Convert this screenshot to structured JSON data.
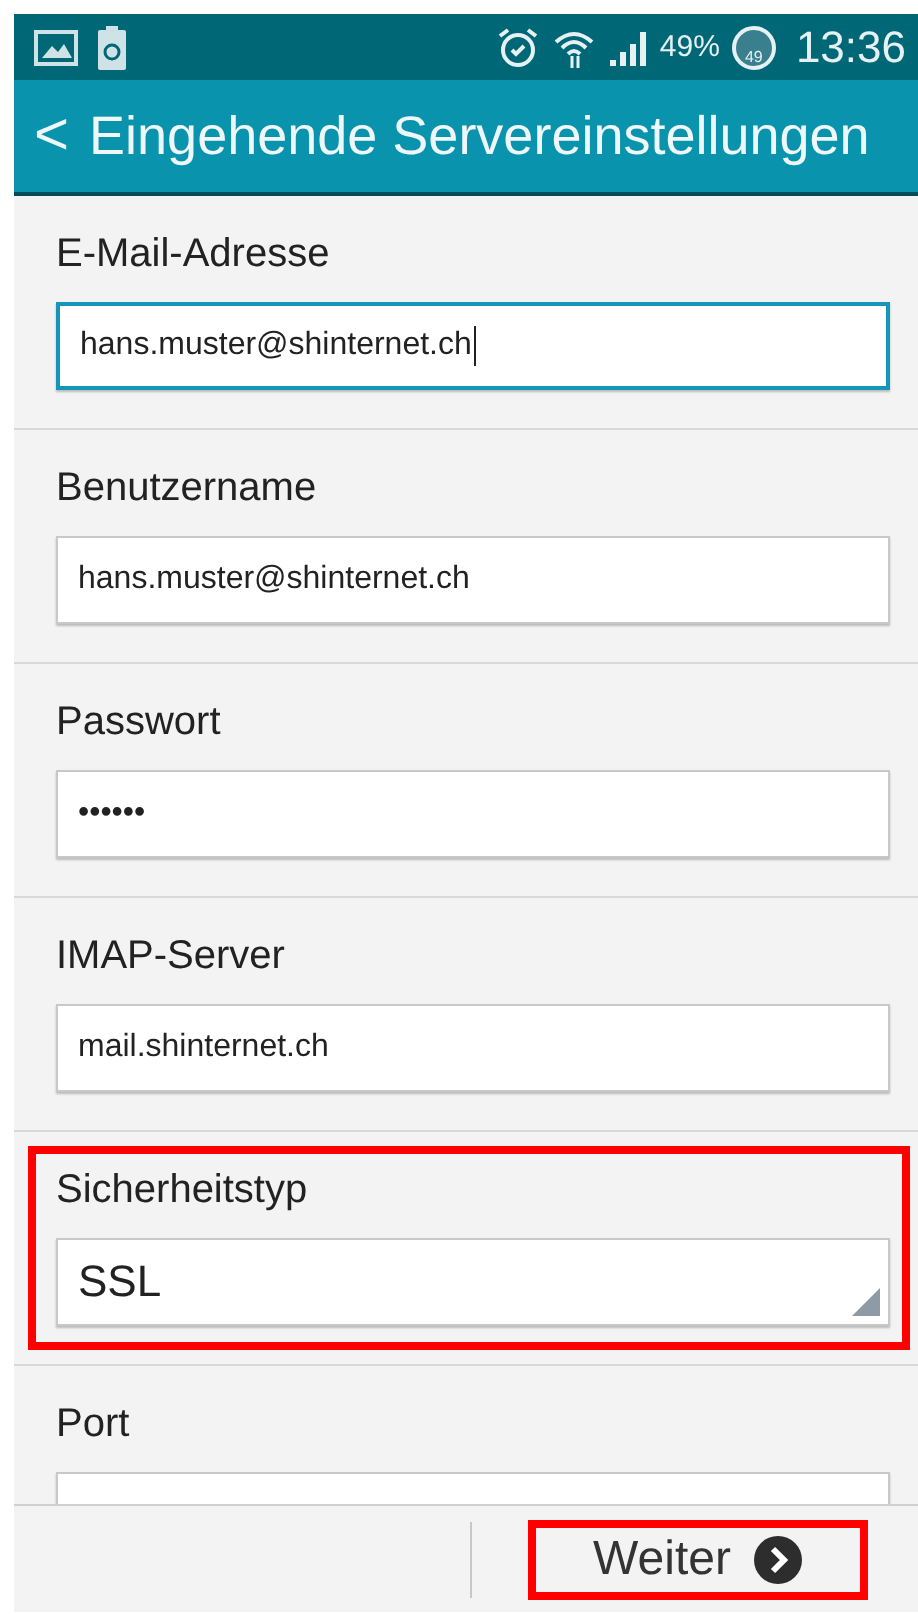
{
  "status_bar": {
    "battery_percent": "49%",
    "battery_badge": "49",
    "time": "13:36"
  },
  "app_bar": {
    "back": "<",
    "title": "Eingehende Servereinstellungen"
  },
  "fields": [
    {
      "label": "E-Mail-Adresse",
      "kind": "text",
      "value": "hans.muster@shinternet.ch",
      "focused": true,
      "highlighted": false
    },
    {
      "label": "Benutzername",
      "kind": "text",
      "value": "hans.muster@shinternet.ch",
      "focused": false,
      "highlighted": false
    },
    {
      "label": "Passwort",
      "kind": "password",
      "value": "••••••",
      "focused": false,
      "highlighted": false
    },
    {
      "label": "IMAP-Server",
      "kind": "text",
      "value": "mail.shinternet.ch",
      "focused": false,
      "highlighted": false
    },
    {
      "label": "Sicherheitstyp",
      "kind": "select",
      "value": "SSL",
      "focused": false,
      "highlighted": true
    },
    {
      "label": "Port",
      "kind": "text",
      "focused": false,
      "highlighted": false
    }
  ],
  "bottom_bar": {
    "next_button": {
      "label": "Weiter",
      "highlighted": true
    }
  }
}
